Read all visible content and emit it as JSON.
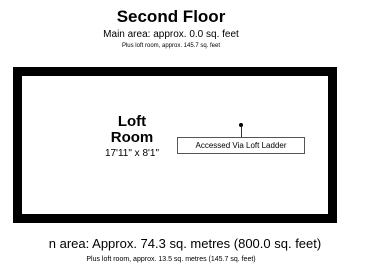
{
  "floor": {
    "title": "Second Floor",
    "main_area": "Main area: approx. 0.0 sq. feet",
    "loft_note": "Plus loft room, approx. 145.7 sq. feet"
  },
  "room": {
    "name_line1": "Loft",
    "name_line2": "Room",
    "dimensions": "17'11\" x 8'1\"",
    "access_label": "Accessed Via Loft Ladder"
  },
  "totals": {
    "main_area": "n area: Approx. 74.3 sq. metres (800.0 sq. feet)",
    "loft_note": "Plus loft room, approx. 13.5 sq. metres (145.7 sq. feet)"
  }
}
